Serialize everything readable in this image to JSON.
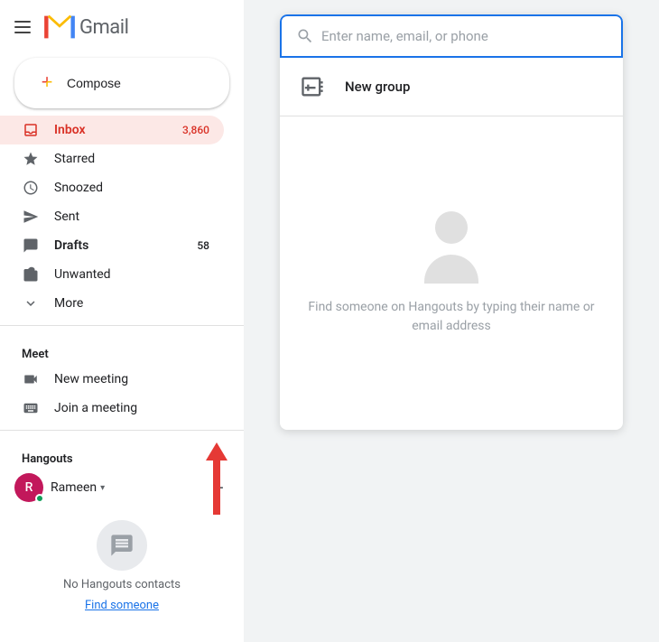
{
  "app": {
    "title": "Gmail",
    "logo_text": "Gmail"
  },
  "sidebar": {
    "compose_label": "Compose",
    "nav_items": [
      {
        "id": "inbox",
        "label": "Inbox",
        "count": "3,860",
        "active": true,
        "bold": false
      },
      {
        "id": "starred",
        "label": "Starred",
        "count": null,
        "active": false,
        "bold": false
      },
      {
        "id": "snoozed",
        "label": "Snoozed",
        "count": null,
        "active": false,
        "bold": false
      },
      {
        "id": "sent",
        "label": "Sent",
        "count": null,
        "active": false,
        "bold": false
      },
      {
        "id": "drafts",
        "label": "Drafts",
        "count": "58",
        "active": false,
        "bold": true
      },
      {
        "id": "unwanted",
        "label": "Unwanted",
        "count": null,
        "active": false,
        "bold": false
      },
      {
        "id": "more",
        "label": "More",
        "count": null,
        "active": false,
        "bold": false
      }
    ],
    "meet_header": "Meet",
    "meet_items": [
      {
        "id": "new-meeting",
        "label": "New meeting"
      },
      {
        "id": "join-meeting",
        "label": "Join a meeting"
      }
    ],
    "hangouts_header": "Hangouts",
    "hangouts_user": {
      "name": "Rameen",
      "initial": "R"
    },
    "no_contacts_text": "No Hangouts contacts",
    "find_someone_label": "Find someone"
  },
  "popup": {
    "search_placeholder": "Enter name, email, or phone",
    "new_group_label": "New group",
    "empty_state_text": "Find someone on Hangouts by typing their name or email address"
  },
  "icons": {
    "hamburger": "☰",
    "search": "🔍",
    "inbox_icon": "□",
    "star": "★",
    "clock": "🕐",
    "send": "➤",
    "draft": "📄",
    "folder": "📁",
    "chevron_down": "▾",
    "video": "📹",
    "keyboard": "⌨",
    "add_person": "👥",
    "plus": "+",
    "chat": "💬"
  }
}
